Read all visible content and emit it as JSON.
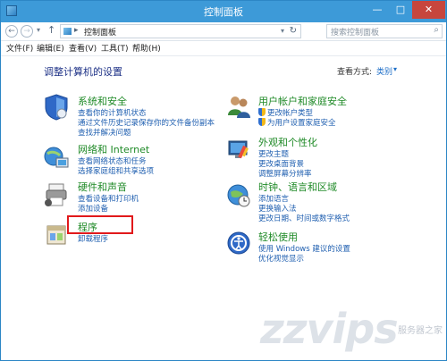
{
  "window": {
    "title": "控制面板",
    "minimize_glyph": "—",
    "maximize_glyph": "□",
    "close_glyph": "✕"
  },
  "address_bar": {
    "back_glyph": "←",
    "forward_glyph": "→",
    "dropdown_glyph": "▾",
    "up_glyph": "↑",
    "chevron_glyph": "▸",
    "path": "控制面板",
    "refresh_glyph": "↻",
    "search_placeholder": "搜索控制面板",
    "search_glyph": "⌕"
  },
  "menu": [
    "文件(F)",
    "编辑(E)",
    "查看(V)",
    "工具(T)",
    "帮助(H)"
  ],
  "content": {
    "heading": "调整计算机的设置",
    "view_by_label": "查看方式:",
    "view_by_value": "类别",
    "view_by_arrow": "▾"
  },
  "categories_left": [
    {
      "title": "系统和安全",
      "links": [
        "查看你的计算机状态",
        "通过文件历史记录保存你的文件备份副本",
        "查找并解决问题"
      ]
    },
    {
      "title": "网络和 Internet",
      "links": [
        "查看网络状态和任务",
        "选择家庭组和共享选项"
      ]
    },
    {
      "title": "硬件和声音",
      "links": [
        "查看设备和打印机",
        "添加设备"
      ]
    },
    {
      "title": "程序",
      "links": [
        "卸载程序"
      ]
    }
  ],
  "categories_right": [
    {
      "title": "用户帐户和家庭安全",
      "links": [
        "更改帐户类型",
        "为用户设置家庭安全"
      ]
    },
    {
      "title": "外观和个性化",
      "links": [
        "更改主题",
        "更改桌面背景",
        "调整屏幕分辨率"
      ]
    },
    {
      "title": "时钟、语言和区域",
      "links": [
        "添加语言",
        "更换输入法",
        "更改日期、时间或数字格式"
      ]
    },
    {
      "title": "轻松使用",
      "links": [
        "使用 Windows 建议的设置",
        "优化视觉显示"
      ]
    }
  ],
  "watermark": {
    "text": "zzvips",
    "sub": "服务器之家"
  },
  "colors": {
    "title_bar": "#3d9ad8",
    "category_title": "#1f8a27",
    "link": "#1f5fb0",
    "highlight": "#e1191b"
  }
}
